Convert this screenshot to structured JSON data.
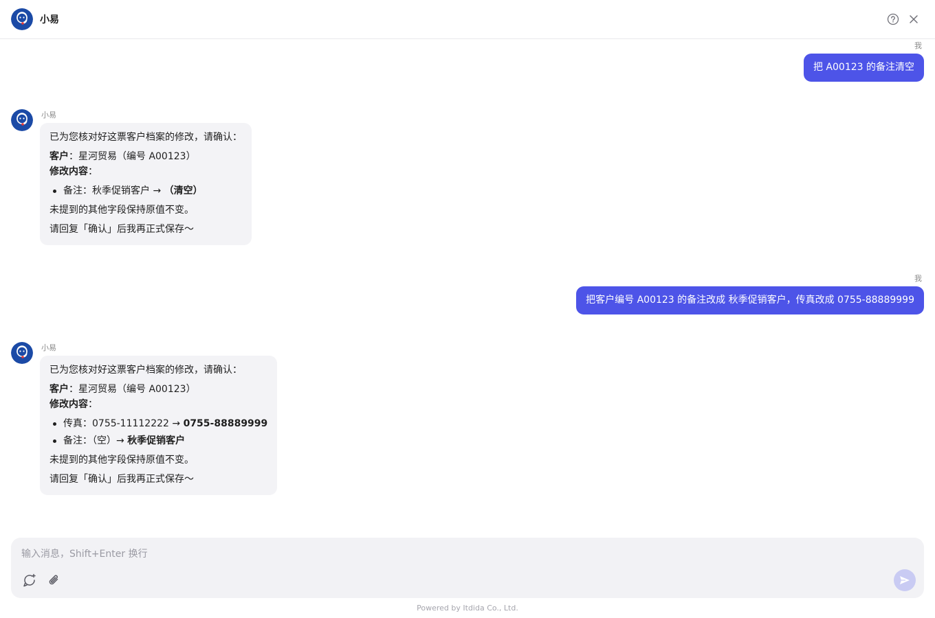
{
  "header": {
    "title": "小易",
    "help_icon": "question-circle-icon",
    "close_icon": "close-icon"
  },
  "messages": [
    {
      "role": "user",
      "sender": "我",
      "text": "把 A00123 的备注清空"
    },
    {
      "role": "assistant",
      "sender": "小易",
      "intro": "已为您核对好这票客户档案的修改，请确认：",
      "customer_label": "客户",
      "customer_value": "：星河贸易（编号 A00123）",
      "changes_label": "修改内容",
      "changes_colon": "：",
      "changes": [
        {
          "field": "备注：秋季促销客户 → ",
          "new_value": "（清空）"
        }
      ],
      "note": "未提到的其他字段保持原值不变。",
      "confirm": "请回复「确认」后我再正式保存～"
    },
    {
      "role": "user",
      "sender": "我",
      "text": "把客户编号 A00123 的备注改成 秋季促销客户，传真改成 0755-88889999"
    },
    {
      "role": "assistant",
      "sender": "小易",
      "intro": "已为您核对好这票客户档案的修改，请确认：",
      "customer_label": "客户",
      "customer_value": "：星河贸易（编号 A00123）",
      "changes_label": "修改内容",
      "changes_colon": "：",
      "changes": [
        {
          "field": "传真：0755-11112222 → ",
          "new_value": "0755-88889999"
        },
        {
          "field": "备注：（空）→ ",
          "new_value": "秋季促销客户"
        }
      ],
      "note": "未提到的其他字段保持原值不变。",
      "confirm": "请回复「确认」后我再正式保存～"
    }
  ],
  "composer": {
    "placeholder": "输入消息，Shift+Enter 换行",
    "new_chat_icon": "new-chat-icon",
    "attach_icon": "paperclip-icon",
    "send_icon": "send-icon"
  },
  "footer": {
    "text": "Powered by Itdida Co., Ltd."
  },
  "colors": {
    "accent": "#4d54e8",
    "assistant_bubble": "#f3f3f6",
    "send_disabled": "#c9cbf3",
    "avatar_bg": "#1b4aa6"
  }
}
